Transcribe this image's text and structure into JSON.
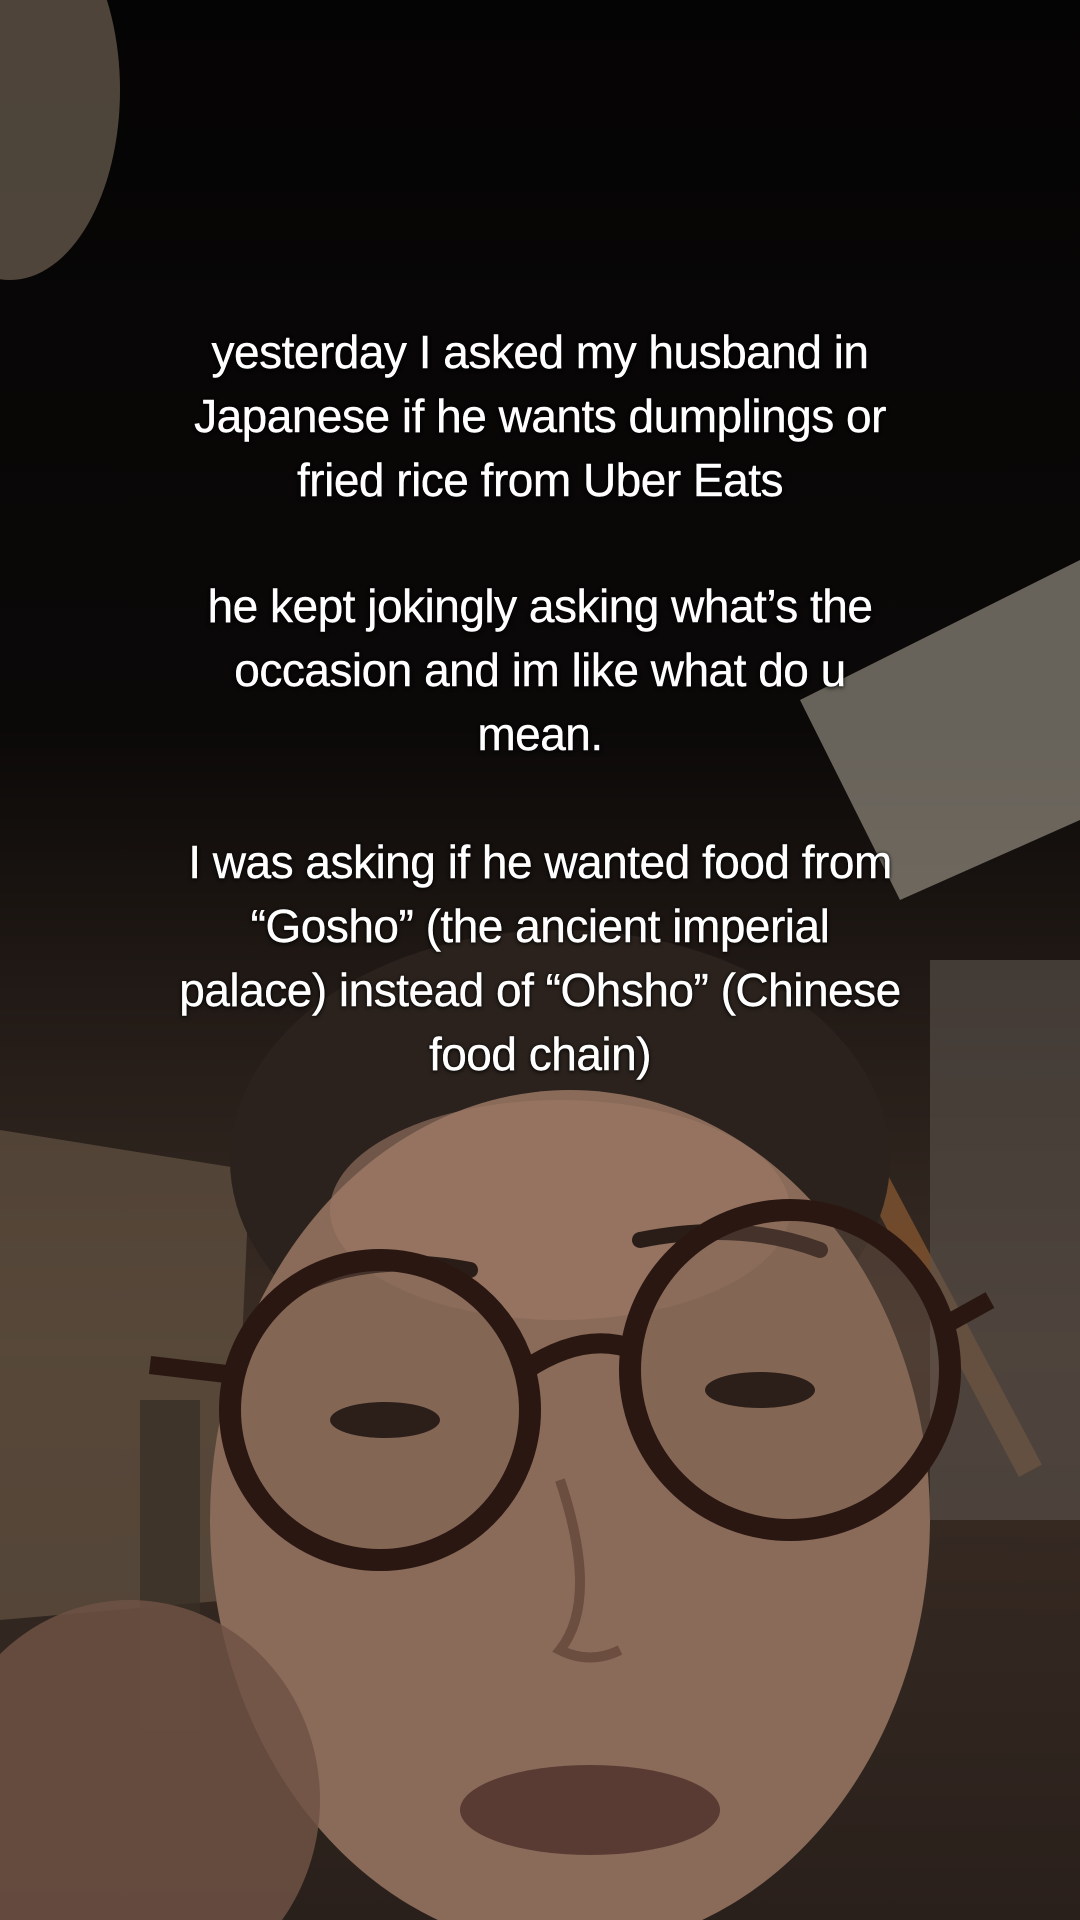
{
  "caption": {
    "paragraph_1": "yesterday I asked my husband in\nJapanese if he wants dumplings or\nfried rice from Uber Eats",
    "paragraph_2": "he kept jokingly asking what’s the\noccasion and im like what do u\nmean.",
    "paragraph_3": "I was asking if he wanted food from\n“Gosho” (the ancient imperial\npalace) instead of “Ohsho” (Chinese\nfood chain)"
  }
}
